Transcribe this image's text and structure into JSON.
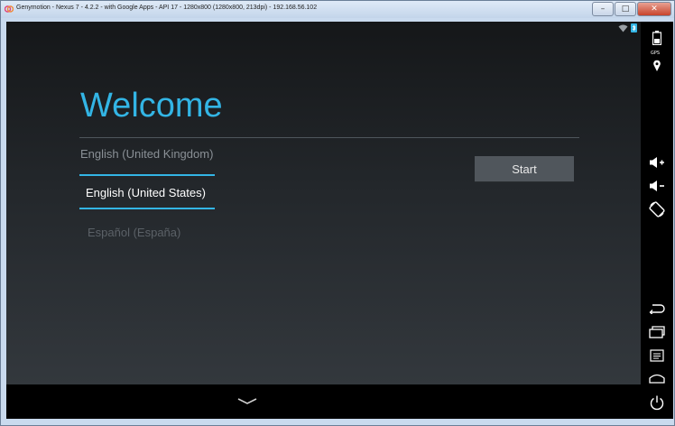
{
  "window": {
    "title": "Genymotion - Nexus 7 - 4.2.2 - with Google Apps - API 17 - 1280x800 (1280x800, 213dpi) - 192.168.56.102",
    "buttons": {
      "minimize": "–",
      "maximize": "□",
      "close": "✕"
    }
  },
  "screen": {
    "heading": "Welcome",
    "languages": [
      "English (United Kingdom)",
      "English (United States)",
      "Español (España)"
    ],
    "start_button": "Start"
  },
  "sidebar": {
    "gps_label": "GPS",
    "icons": [
      "battery-icon",
      "gps-icon",
      "volume-up-icon",
      "volume-down-icon",
      "rotate-icon",
      "back-icon",
      "recent-apps-icon",
      "menu-icon",
      "home-icon",
      "power-icon"
    ]
  },
  "colors": {
    "accent": "#33b5e5",
    "screen_bg": "#1c1f22",
    "title_bar": "#c9daee"
  }
}
